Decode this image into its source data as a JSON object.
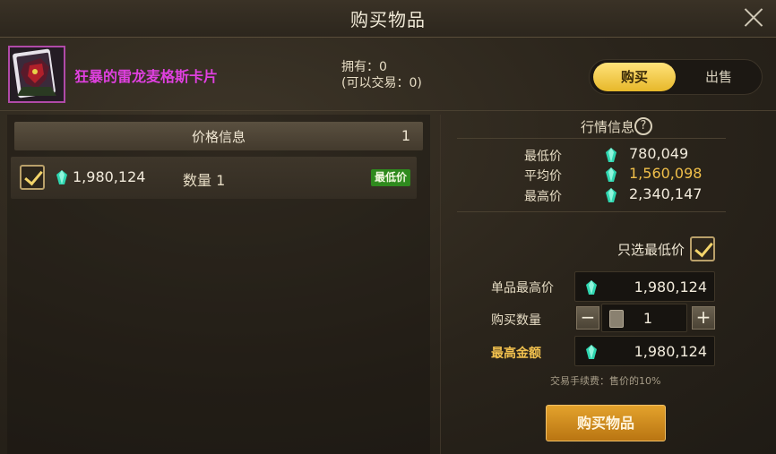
{
  "window": {
    "title": "购买物品",
    "close_icon": "close-icon"
  },
  "item": {
    "name": "狂暴的雷龙麦格斯卡片",
    "owned": "拥有：0",
    "tradable": "(可以交易：0)",
    "name_color": "#e040e0",
    "frame_color": "#b04aa8"
  },
  "mode_toggle": {
    "buy": "购买",
    "sell": "出售",
    "active": "buy"
  },
  "price_list": {
    "title": "价格信息",
    "count": "1",
    "rows": [
      {
        "checked": true,
        "price": "1,980,124",
        "quantity": "数量 1",
        "badge": "最低价"
      }
    ]
  },
  "market": {
    "title": "行情信息",
    "help_icon": "question-circle-icon",
    "lowest": {
      "label": "最低价",
      "value": "780,049"
    },
    "average": {
      "label": "平均价",
      "value": "1,560,098"
    },
    "highest": {
      "label": "最高价",
      "value": "2,340,147"
    }
  },
  "order": {
    "only_lowest_label": "只选最低价",
    "only_lowest_checked": true,
    "max_unit_price_label": "单品最高价",
    "max_unit_price": "1,980,124",
    "quantity_label": "购买数量",
    "quantity": "1",
    "minus": "−",
    "plus": "+",
    "max_total_label": "最高金额",
    "max_total": "1,980,124",
    "fee_note": "交易手续费：售价的10%",
    "buy_button": "购买物品"
  },
  "colors": {
    "gem": "#2fd6b0",
    "accent_gold": "#f0bf4a",
    "badge_green": "#2f8a1e"
  }
}
